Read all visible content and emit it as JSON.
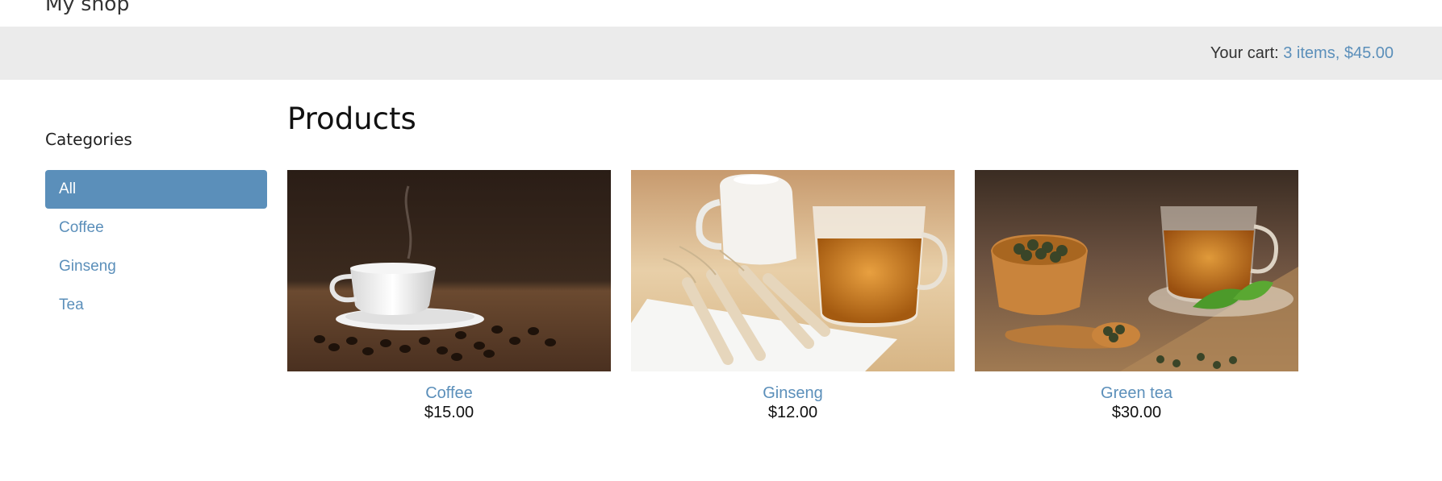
{
  "header": {
    "shop_title": "My shop"
  },
  "cart": {
    "label": "Your cart:",
    "summary": "3 items, $45.00"
  },
  "sidebar": {
    "heading": "Categories",
    "items": [
      {
        "label": "All",
        "active": true
      },
      {
        "label": "Coffee",
        "active": false
      },
      {
        "label": "Ginseng",
        "active": false
      },
      {
        "label": "Tea",
        "active": false
      }
    ]
  },
  "main": {
    "title": "Products",
    "products": [
      {
        "name": "Coffee",
        "price": "$15.00",
        "image": "coffee-cup-photo"
      },
      {
        "name": "Ginseng",
        "price": "$12.00",
        "image": "ginseng-tea-photo"
      },
      {
        "name": "Green tea",
        "price": "$30.00",
        "image": "green-tea-photo"
      }
    ]
  },
  "colors": {
    "accent": "#5b8fba",
    "cart_bar": "#ebebeb"
  }
}
